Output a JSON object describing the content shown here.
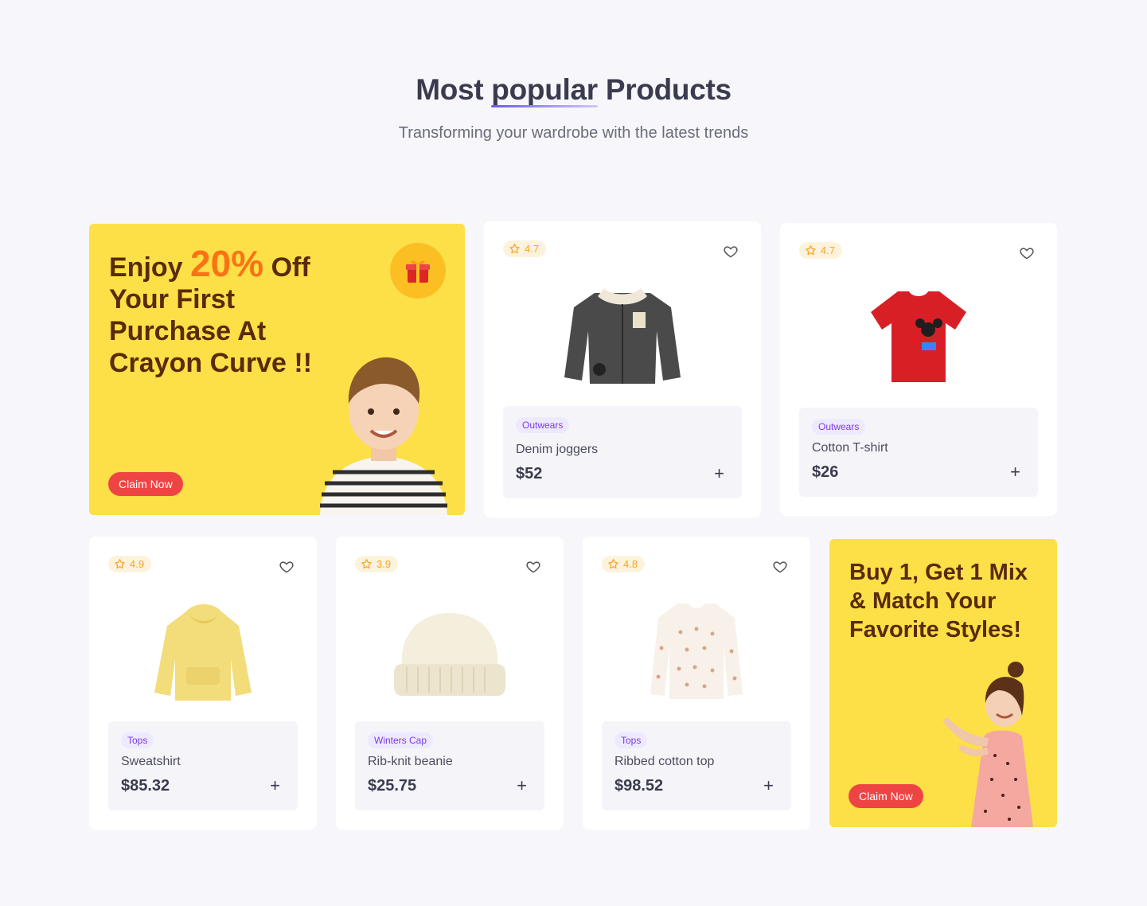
{
  "header": {
    "title_pre": "Most",
    "title_highlight": "popular",
    "title_post": "Products",
    "subtitle": "Transforming your wardrobe with the latest trends"
  },
  "promo_top": {
    "line_enjoy": "Enjoy",
    "line_pct": "20%",
    "line_rest": "Off Your First Purchase At Crayon Curve !!",
    "button": "Claim Now",
    "icon": "gift-icon"
  },
  "promo_bottom": {
    "text": "Buy 1, Get 1 Mix & Match Your Favorite Styles!",
    "button": "Claim Now"
  },
  "products": [
    {
      "rating": "4.7",
      "category": "Outwears",
      "name": "Denim joggers",
      "price": "$52",
      "image": "denim-jacket"
    },
    {
      "rating": "4.7",
      "category": "Outwears",
      "name": "Cotton T-shirt",
      "price": "$26",
      "image": "red-tshirt"
    },
    {
      "rating": "4.9",
      "category": "Tops",
      "name": "Sweatshirt",
      "price": "$85.32",
      "image": "yellow-hoodie"
    },
    {
      "rating": "3.9",
      "category": "Winters Cap",
      "name": "Rib-knit beanie",
      "price": "$25.75",
      "image": "cream-beanie"
    },
    {
      "rating": "4.8",
      "category": "Tops",
      "name": "Ribbed cotton top",
      "price": "$98.52",
      "image": "floral-top"
    }
  ],
  "colors": {
    "promo_bg": "#fde047",
    "promo_text": "#5a2a0b",
    "accent_orange": "#f97316",
    "button_red": "#ef4444",
    "tag_purple": "#7c3aed",
    "rating_gold": "#f5a524"
  }
}
